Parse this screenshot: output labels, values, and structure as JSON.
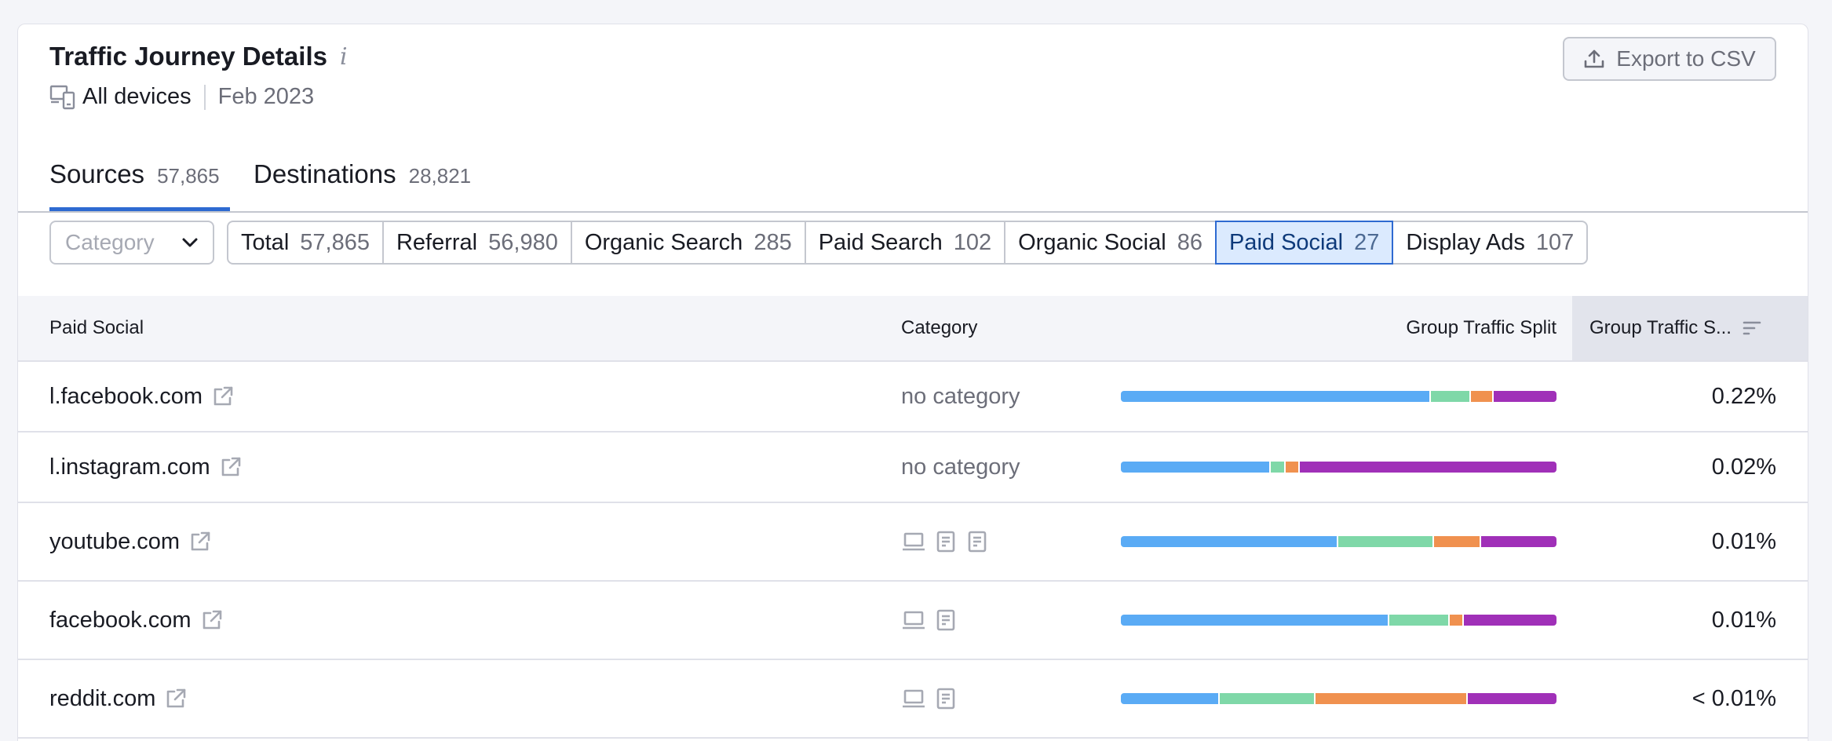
{
  "header": {
    "title": "Traffic Journey Details",
    "devices": "All devices",
    "date": "Feb 2023",
    "export_label": "Export to CSV"
  },
  "tabs": [
    {
      "label": "Sources",
      "count": "57,865",
      "active": true
    },
    {
      "label": "Destinations",
      "count": "28,821",
      "active": false
    }
  ],
  "filters": {
    "category_placeholder": "Category",
    "chips": [
      {
        "label": "Total",
        "count": "57,865"
      },
      {
        "label": "Referral",
        "count": "56,980"
      },
      {
        "label": "Organic Search",
        "count": "285"
      },
      {
        "label": "Paid Search",
        "count": "102"
      },
      {
        "label": "Organic Social",
        "count": "86"
      },
      {
        "label": "Paid Social",
        "count": "27"
      },
      {
        "label": "Display Ads",
        "count": "107"
      }
    ],
    "active_chip": "Paid Social"
  },
  "table": {
    "headers": {
      "col1": "Paid Social",
      "col2": "Category",
      "col3": "Group Traffic Split",
      "col4": "Group Traffic S..."
    },
    "split_colors": {
      "blue": "#5aabf5",
      "green": "#7fd8a8",
      "orange": "#f0914f",
      "purple": "#a030b8"
    },
    "rows": [
      {
        "domain": "l.facebook.com",
        "category": "no category",
        "icons": [],
        "split": [
          0.715,
          0.09,
          0.05,
          0.145
        ],
        "share": "0.22%"
      },
      {
        "domain": "l.instagram.com",
        "category": "no category",
        "icons": [],
        "split": [
          0.345,
          0.03,
          0.03,
          0.595
        ],
        "share": "0.02%"
      },
      {
        "domain": "youtube.com",
        "category": "",
        "icons": [
          "laptop-icon",
          "document-icon",
          "document-icon"
        ],
        "split": [
          0.5,
          0.22,
          0.105,
          0.175
        ],
        "share": "0.01%"
      },
      {
        "domain": "facebook.com",
        "category": "",
        "icons": [
          "laptop-icon",
          "document-icon"
        ],
        "split": [
          0.62,
          0.135,
          0.03,
          0.215
        ],
        "share": "0.01%"
      },
      {
        "domain": "reddit.com",
        "category": "",
        "icons": [
          "laptop-icon",
          "document-icon"
        ],
        "split": [
          0.225,
          0.22,
          0.35,
          0.205
        ],
        "share": "< 0.01%"
      }
    ]
  }
}
